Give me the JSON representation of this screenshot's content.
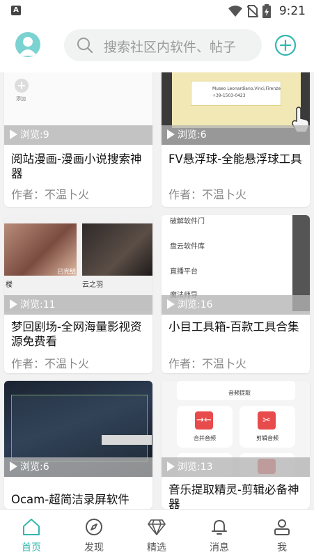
{
  "status_bar": {
    "time": "9:21"
  },
  "header": {
    "search_placeholder": "搜索社区内软件、帖子"
  },
  "cards": [
    {
      "title": "阅站漫画-漫画小说搜索神器",
      "views": "浏览:9",
      "author": "作者：不温卜火",
      "thumb_note": "添加"
    },
    {
      "title": "FV悬浮球-全能悬浮球工具",
      "views": "浏览:6",
      "author": "作者：不温卜火",
      "thumb_note_1": "Museo Leonardiano,Vinci,Firenze",
      "thumb_note_2": "+39-1503-0423"
    },
    {
      "title": "梦回剧场-全网海量影视资源免费看",
      "views": "浏览:11",
      "author": "作者：不温卜火",
      "poster_1": "楼",
      "poster_2": "云之羽",
      "badge": "已完结"
    },
    {
      "title": "小目工具箱-百款工具合集",
      "views": "浏览:16",
      "author": "作者：不温卜火",
      "list_1": "破解软件门",
      "list_2": "盘云软件库",
      "list_3": "直播平台",
      "list_4": "魔法师导"
    },
    {
      "title": "Ocam-超简洁录屏软件",
      "views": "浏览:6",
      "author": ""
    },
    {
      "title": "音乐提取精灵-剪辑必备神器",
      "views": "浏览:13",
      "author": "",
      "tile_top": "音频提取",
      "tile_1": "合并音频",
      "tile_2": "剪辑音频"
    }
  ],
  "bottom_nav": [
    {
      "label": "首页",
      "icon": "home-icon",
      "active": true
    },
    {
      "label": "发现",
      "icon": "compass-icon",
      "active": false
    },
    {
      "label": "精选",
      "icon": "diamond-icon",
      "active": false
    },
    {
      "label": "消息",
      "icon": "bell-icon",
      "active": false
    },
    {
      "label": "我",
      "icon": "user-icon",
      "active": false
    }
  ],
  "colors": {
    "accent": "#34b7b0",
    "icon_red": "#e84b4b"
  }
}
